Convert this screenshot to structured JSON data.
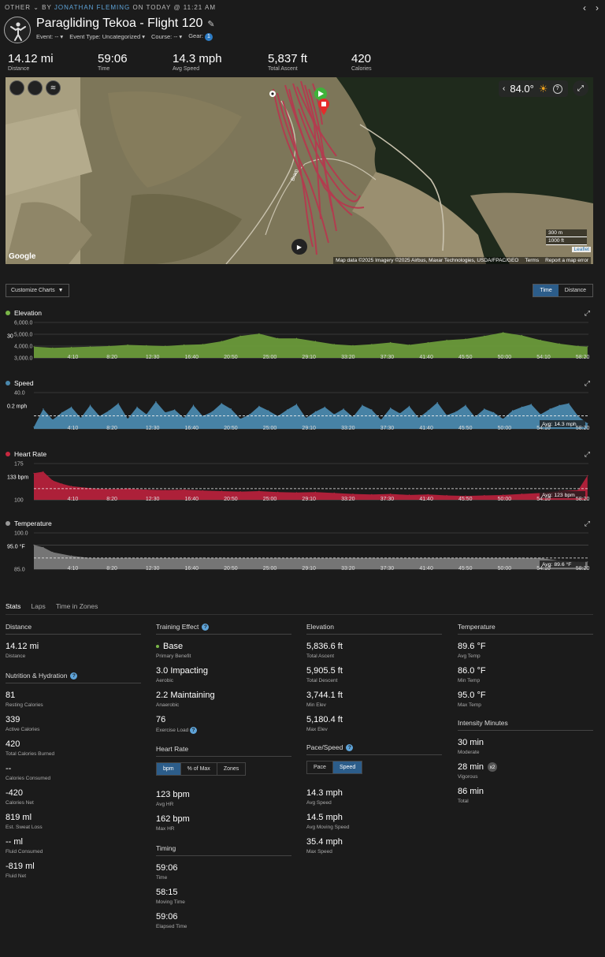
{
  "breadcrumb": {
    "prefix": "OTHER ⌄ BY",
    "author": "JONATHAN FLEMING",
    "suffix": "ON TODAY @ 11:21 AM"
  },
  "activity": {
    "title": "Paragliding Tekoa - Flight 120",
    "event": "Event: --",
    "event_type": "Event Type: Uncategorized",
    "course": "Course: --",
    "gear": "Gear:",
    "gear_count": "1"
  },
  "summary": [
    {
      "value": "14.12 mi",
      "label": "Distance"
    },
    {
      "value": "59:06",
      "label": "Time"
    },
    {
      "value": "14.3 mph",
      "label": "Avg Speed"
    },
    {
      "value": "5,837 ft",
      "label": "Total Ascent"
    },
    {
      "value": "420",
      "label": "Calories"
    }
  ],
  "map": {
    "temperature": "84.0°",
    "help": "?",
    "scale_metric": "300 m",
    "scale_imperial": "1000 ft",
    "leaflet": "Leaflet",
    "google": "Google",
    "attribution": "Map data ©2025 Imagery ©2025 Airbus, Maxar Technologies, USDA/FPAC/GEO",
    "terms": "Terms",
    "report": "Report a map error",
    "road_label": "Bram"
  },
  "controls": {
    "customize": "Customize Charts",
    "time": "Time",
    "distance": "Distance"
  },
  "colors": {
    "elevation": "#6a9a3a",
    "speed": "#4a88ad",
    "heart_rate": "#b5213b",
    "temperature": "#7a7a7a",
    "accent": "#2c5d8a"
  },
  "chart_data": [
    {
      "type": "area",
      "title": "Elevation",
      "x_ticks": [
        "4:10",
        "8:20",
        "12:30",
        "16:40",
        "20:50",
        "25:00",
        "29:10",
        "33:20",
        "37:30",
        "41:40",
        "45:50",
        "50:00",
        "54:10",
        "58:20"
      ],
      "y_ticks": [
        "6,000.0",
        "5,000.0",
        "4,000.0",
        "3,000.0"
      ],
      "y_marker": "30",
      "ylim": [
        3000,
        6000
      ],
      "x": [
        0,
        2,
        4,
        6,
        8,
        10,
        12,
        14,
        16,
        18,
        20,
        22,
        24,
        26,
        28,
        30,
        32,
        34,
        36,
        38,
        40,
        42,
        44,
        46,
        48,
        50,
        52,
        54,
        56,
        58,
        59
      ],
      "values": [
        3950,
        3850,
        3900,
        3950,
        4000,
        4100,
        4050,
        4000,
        4100,
        4150,
        4400,
        4850,
        5050,
        4650,
        4650,
        4400,
        4150,
        4050,
        4150,
        4300,
        4100,
        4300,
        4500,
        4600,
        4850,
        5150,
        4900,
        4500,
        4200,
        4000,
        3950
      ]
    },
    {
      "type": "area",
      "title": "Speed",
      "x_ticks": [
        "4:10",
        "8:20",
        "12:30",
        "16:40",
        "20:50",
        "25:00",
        "29:10",
        "33:20",
        "37:30",
        "41:40",
        "45:50",
        "50:00",
        "54:10",
        "58:20"
      ],
      "y_ticks": [
        "40.0"
      ],
      "y_marker": "0.2 mph",
      "avg_label": "Avg: 14.3 mph",
      "ylim": [
        0,
        40
      ],
      "x": [
        0,
        1,
        2,
        3,
        4,
        5,
        6,
        7,
        8,
        9,
        10,
        11,
        12,
        13,
        14,
        15,
        16,
        17,
        18,
        19,
        20,
        21,
        22,
        23,
        24,
        25,
        26,
        27,
        28,
        29,
        30,
        31,
        32,
        33,
        34,
        35,
        36,
        37,
        38,
        39,
        40,
        41,
        42,
        43,
        44,
        45,
        46,
        47,
        48,
        49,
        50,
        51,
        52,
        53,
        54,
        55,
        56,
        57,
        58,
        59
      ],
      "values": [
        2,
        22,
        10,
        18,
        24,
        12,
        26,
        14,
        20,
        28,
        11,
        24,
        16,
        30,
        18,
        21,
        12,
        26,
        14,
        19,
        28,
        22,
        11,
        16,
        25,
        20,
        14,
        21,
        27,
        12,
        19,
        24,
        16,
        22,
        13,
        26,
        21,
        10,
        23,
        17,
        25,
        12,
        20,
        29,
        15,
        19,
        26,
        13,
        22,
        18,
        11,
        20,
        24,
        27,
        16,
        22,
        26,
        28,
        14,
        6
      ],
      "avg": 14.3
    },
    {
      "type": "area",
      "title": "Heart Rate",
      "x_ticks": [
        "4:10",
        "8:20",
        "12:30",
        "16:40",
        "20:50",
        "25:00",
        "29:10",
        "33:20",
        "37:30",
        "41:40",
        "45:50",
        "50:00",
        "54:10",
        "58:20"
      ],
      "y_ticks": [
        "175",
        "150",
        "100"
      ],
      "y_marker": "133 bpm",
      "avg_label": "Avg: 123 bpm",
      "ylim": [
        100,
        175
      ],
      "x": [
        0,
        1,
        2,
        3,
        4,
        6,
        8,
        10,
        12,
        14,
        16,
        18,
        20,
        22,
        24,
        26,
        28,
        30,
        32,
        34,
        36,
        38,
        40,
        42,
        44,
        46,
        48,
        50,
        52,
        54,
        56,
        58,
        59
      ],
      "values": [
        155,
        158,
        140,
        133,
        128,
        124,
        122,
        123,
        121,
        120,
        121,
        119,
        118,
        117,
        118,
        116,
        115,
        116,
        114,
        112,
        111,
        112,
        110,
        111,
        109,
        108,
        109,
        110,
        112,
        114,
        118,
        120,
        150
      ],
      "avg": 123
    },
    {
      "type": "area",
      "title": "Temperature",
      "x_ticks": [
        "4:10",
        "8:20",
        "12:30",
        "16:40",
        "20:50",
        "25:00",
        "29:10",
        "33:20",
        "37:30",
        "41:40",
        "45:50",
        "50:00",
        "54:10",
        "58:20"
      ],
      "y_ticks": [
        "100.0",
        "95.0",
        "85.0"
      ],
      "y_marker": "95.0 °F",
      "avg_label": "Avg: 89.6 °F",
      "ylim": [
        85,
        100
      ],
      "x": [
        0,
        1,
        2,
        4,
        6,
        8,
        10,
        12,
        14,
        16,
        18,
        20,
        22,
        24,
        26,
        28,
        30,
        32,
        34,
        36,
        38,
        40,
        42,
        44,
        46,
        48,
        50,
        52,
        54,
        56,
        58,
        59
      ],
      "values": [
        95,
        94,
        92,
        90.5,
        89.6,
        89.6,
        89.6,
        89.6,
        89.6,
        89.6,
        89.6,
        89.6,
        89.6,
        89.6,
        89.6,
        89.6,
        89.6,
        89.6,
        89.6,
        89.6,
        89.6,
        89.6,
        89.6,
        89.6,
        89.6,
        89.6,
        89.6,
        89.6,
        89.6,
        88.5,
        88,
        88
      ],
      "avg": 89.6
    }
  ],
  "tabs": [
    "Stats",
    "Laps",
    "Time in Zones"
  ],
  "stats": {
    "distance": {
      "head": "Distance",
      "items": [
        {
          "value": "14.12 mi",
          "label": "Distance"
        }
      ]
    },
    "nutrition": {
      "head": "Nutrition & Hydration",
      "items": [
        {
          "value": "81",
          "label": "Resting Calories"
        },
        {
          "value": "339",
          "label": "Active Calories"
        },
        {
          "value": "420",
          "label": "Total Calories Burned"
        },
        {
          "value": "--",
          "label": "Calories Consumed"
        },
        {
          "value": "-420",
          "label": "Calories Net"
        },
        {
          "value": "819 ml",
          "label": "Est. Sweat Loss"
        },
        {
          "value": "-- ml",
          "label": "Fluid Consumed"
        },
        {
          "value": "-819 ml",
          "label": "Fluid Net"
        }
      ]
    },
    "training": {
      "head": "Training Effect",
      "items": [
        {
          "value": "Base",
          "label": "Primary Benefit"
        },
        {
          "value": "3.0 Impacting",
          "label": "Aerobic"
        },
        {
          "value": "2.2 Maintaining",
          "label": "Anaerobic"
        },
        {
          "value": "76",
          "label": "Exercise Load"
        }
      ]
    },
    "heart_rate": {
      "head": "Heart Rate",
      "tabs": [
        "bpm",
        "% of Max",
        "Zones"
      ],
      "items": [
        {
          "value": "123 bpm",
          "label": "Avg HR"
        },
        {
          "value": "162 bpm",
          "label": "Max HR"
        }
      ]
    },
    "timing": {
      "head": "Timing",
      "items": [
        {
          "value": "59:06",
          "label": "Time"
        },
        {
          "value": "58:15",
          "label": "Moving Time"
        },
        {
          "value": "59:06",
          "label": "Elapsed Time"
        }
      ]
    },
    "elevation": {
      "head": "Elevation",
      "items": [
        {
          "value": "5,836.6 ft",
          "label": "Total Ascent"
        },
        {
          "value": "5,905.5 ft",
          "label": "Total Descent"
        },
        {
          "value": "3,744.1 ft",
          "label": "Min Elev"
        },
        {
          "value": "5,180.4 ft",
          "label": "Max Elev"
        }
      ]
    },
    "pace_speed": {
      "head": "Pace/Speed",
      "tabs": [
        "Pace",
        "Speed"
      ],
      "items": [
        {
          "value": "14.3 mph",
          "label": "Avg Speed"
        },
        {
          "value": "14.5 mph",
          "label": "Avg Moving Speed"
        },
        {
          "value": "35.4 mph",
          "label": "Max Speed"
        }
      ]
    },
    "temperature": {
      "head": "Temperature",
      "items": [
        {
          "value": "89.6 °F",
          "label": "Avg Temp"
        },
        {
          "value": "86.0 °F",
          "label": "Min Temp"
        },
        {
          "value": "95.0 °F",
          "label": "Max Temp"
        }
      ]
    },
    "intensity": {
      "head": "Intensity Minutes",
      "badge": "x2",
      "items": [
        {
          "value": "30 min",
          "label": "Moderate"
        },
        {
          "value": "28 min",
          "label": "Vigorous"
        },
        {
          "value": "86 min",
          "label": "Total"
        }
      ]
    }
  }
}
